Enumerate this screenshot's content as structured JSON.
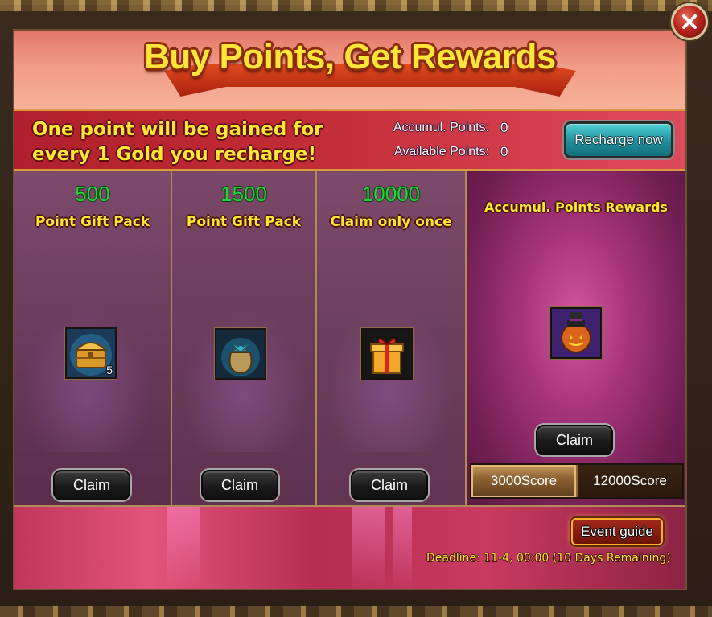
{
  "header": {
    "title": "Buy Points, Get Rewards"
  },
  "info": {
    "description": "One point will be gained for every 1 Gold you recharge!",
    "accumul_label": "Accumul. Points:",
    "accumul_value": "0",
    "available_label": "Available Points:",
    "available_value": "0",
    "recharge_label": "Recharge now"
  },
  "packs": [
    {
      "points": "500",
      "name": "Point Gift Pack",
      "icon": "treasure-chest-icon",
      "quantity": "5",
      "claim_label": "Claim"
    },
    {
      "points": "1500",
      "name": "Point Gift Pack",
      "icon": "gift-bag-icon",
      "quantity": "",
      "claim_label": "Claim"
    },
    {
      "points": "10000",
      "name": "Claim only once",
      "icon": "gift-box-icon",
      "quantity": "",
      "claim_label": "Claim"
    }
  ],
  "accumulated": {
    "title": "Accumul. Points Rewards",
    "icon": "pumpkin-mascot-icon",
    "claim_label": "Claim",
    "tabs": [
      {
        "label": "3000Score",
        "active": true
      },
      {
        "label": "12000Score",
        "active": false
      }
    ]
  },
  "footer": {
    "guide_label": "Event guide",
    "deadline": "Deadline: 11-4, 00:00 (10 Days Remaining)"
  },
  "colors": {
    "title_yellow": "#ffe43a",
    "points_green": "#25d33a",
    "recharge_teal": "#1e8e9a"
  }
}
